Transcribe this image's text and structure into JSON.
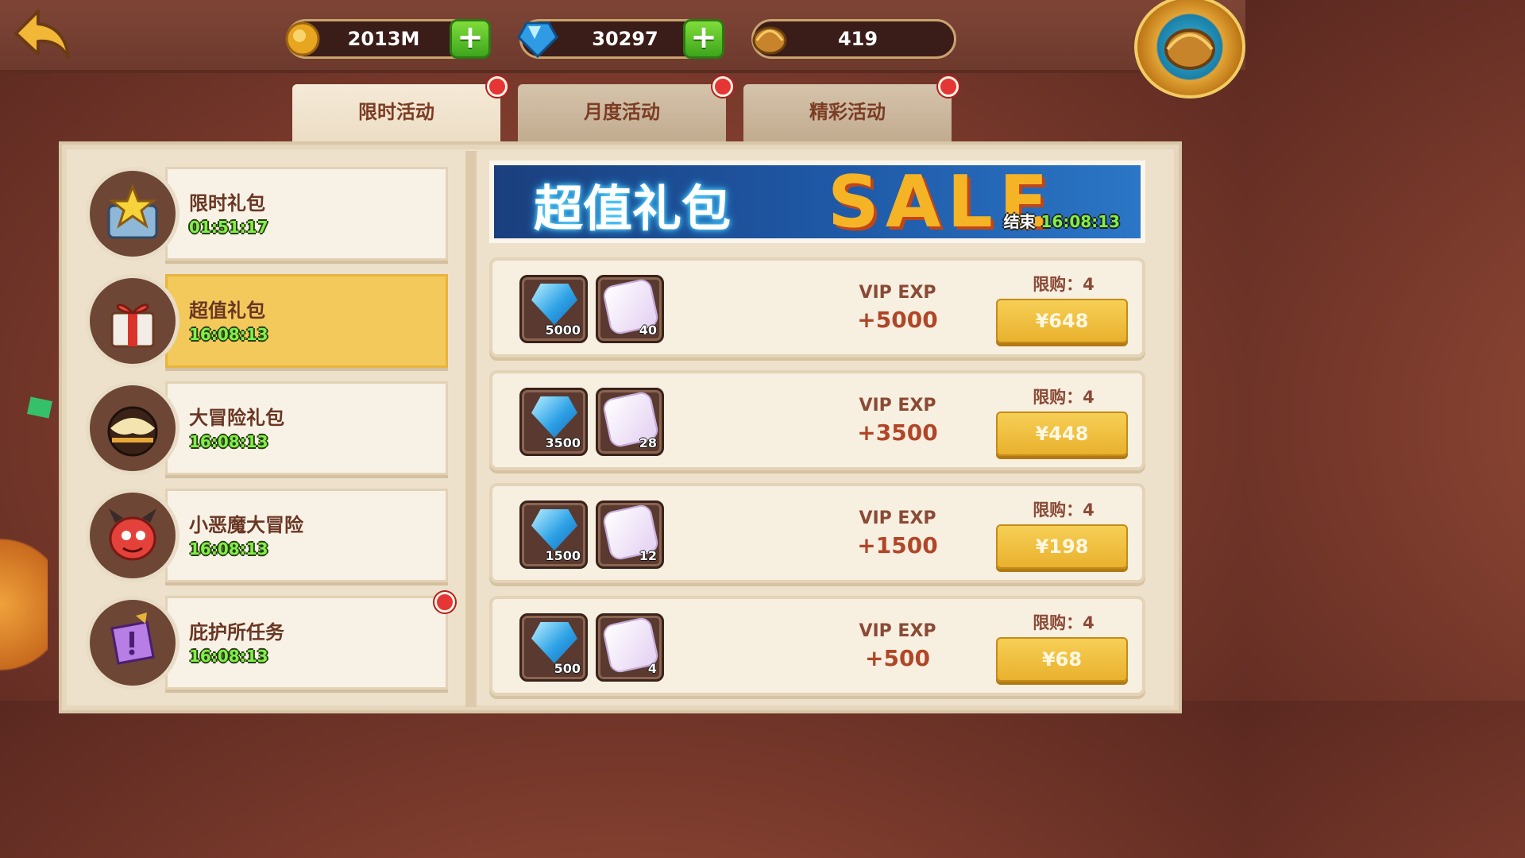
{
  "currency": {
    "gold": {
      "icon": "gold-coin-icon",
      "value": "2013M"
    },
    "gems": {
      "icon": "blue-gem-icon",
      "value": "30297"
    },
    "shells": {
      "icon": "shell-icon",
      "value": "419"
    }
  },
  "tabs": [
    {
      "label": "限时活动",
      "active": true,
      "has_dot": true
    },
    {
      "label": "月度活动",
      "active": false,
      "has_dot": true
    },
    {
      "label": "精彩活动",
      "active": false,
      "has_dot": true
    }
  ],
  "sidebar": [
    {
      "name": "限时礼包",
      "time": "01:51:17",
      "icon": "star-chest-icon",
      "active": false,
      "has_dot": false
    },
    {
      "name": "超值礼包",
      "time": "16:08:13",
      "icon": "gift-box-icon",
      "active": true,
      "has_dot": false
    },
    {
      "name": "大冒险礼包",
      "time": "16:08:13",
      "icon": "donut-icon",
      "active": false,
      "has_dot": false
    },
    {
      "name": "小恶魔大冒险",
      "time": "16:08:13",
      "icon": "little-devil-icon",
      "active": false,
      "has_dot": false
    },
    {
      "name": "庇护所任务",
      "time": "16:08:13",
      "icon": "quest-scroll-icon",
      "active": false,
      "has_dot": true
    }
  ],
  "banner": {
    "title": "超值礼包",
    "sale_text": "SALE",
    "end_label": "结束",
    "end_time": "16:08:13"
  },
  "offers": [
    {
      "gems": "5000",
      "dice": "40",
      "vip_label": "VIP EXP",
      "vip_value": "+5000",
      "limit": "限购：4",
      "price": "¥648"
    },
    {
      "gems": "3500",
      "dice": "28",
      "vip_label": "VIP EXP",
      "vip_value": "+3500",
      "limit": "限购：4",
      "price": "¥448"
    },
    {
      "gems": "1500",
      "dice": "12",
      "vip_label": "VIP EXP",
      "vip_value": "+1500",
      "limit": "限购：4",
      "price": "¥198"
    },
    {
      "gems": "500",
      "dice": "4",
      "vip_label": "VIP EXP",
      "vip_value": "+500",
      "limit": "限购：4",
      "price": "¥68"
    }
  ],
  "colors": {
    "accent_gold": "#f3c95c",
    "timer_green": "#7ff04a",
    "notify_red": "#e53535"
  }
}
